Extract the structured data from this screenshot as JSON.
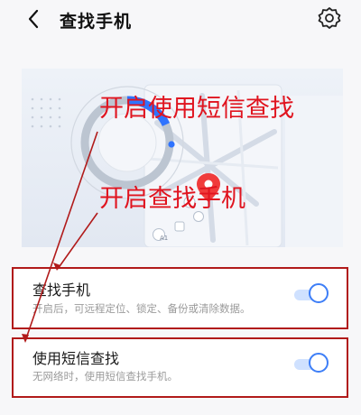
{
  "header": {
    "title": "查找手机",
    "back_icon": "chevron-left-icon",
    "settings_icon": "gear-icon"
  },
  "banner": {
    "annotation_sms": "开启使用短信查找",
    "annotation_find": "开启查找手机",
    "map_badge_label": "A1",
    "annotation_color": "#e0141f",
    "accent_color": "#2f73ff",
    "pin_color": "#f03b3b"
  },
  "settings": {
    "items": [
      {
        "title": "查找手机",
        "description": "开启后，可远程定位、锁定、备份或清除数据。",
        "enabled": true
      },
      {
        "title": "使用短信查找",
        "description": "无网络时，使用短信查找手机。",
        "enabled": true
      }
    ]
  },
  "colors": {
    "toggle_on": "#3d7ef7",
    "highlight_box": "#b11a1a"
  }
}
